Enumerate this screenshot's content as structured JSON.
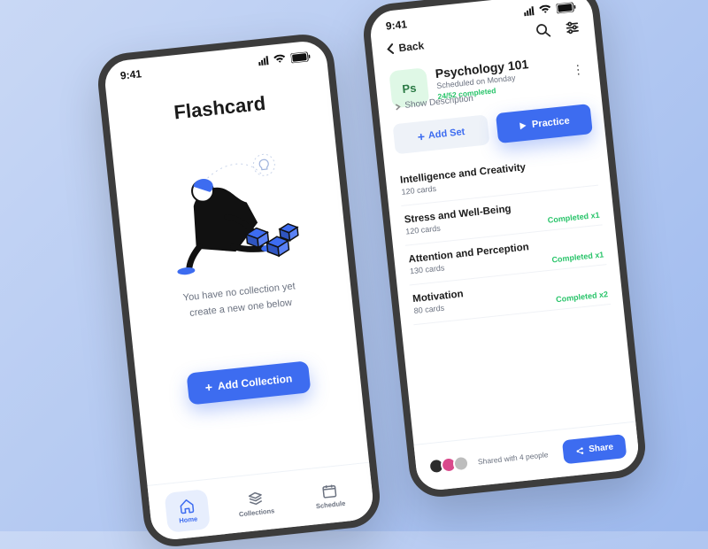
{
  "status_time": "9:41",
  "left": {
    "title": "Flashcard",
    "empty_line1": "You have no collection yet",
    "empty_line2": "create a new one below",
    "add_btn": "Add Collection",
    "tabs": [
      "Home",
      "Collections",
      "Schedule"
    ]
  },
  "right": {
    "back": "Back",
    "icon": "Ps",
    "title": "Psychology 101",
    "subtitle": "Scheduled on Monday",
    "progress": "24/52 completed",
    "show_desc": "Show Description",
    "add_set": "Add Set",
    "practice": "Practice",
    "sets": [
      {
        "title": "Intelligence and Creativity",
        "sub": "120 cards",
        "tag": ""
      },
      {
        "title": "Stress and Well-Being",
        "sub": "120 cards",
        "tag": "Completed x1"
      },
      {
        "title": "Attention and Perception",
        "sub": "130 cards",
        "tag": "Completed x1"
      },
      {
        "title": "Motivation",
        "sub": "80 cards",
        "tag": "Completed x2"
      }
    ],
    "shared": "Shared with 4 people",
    "share": "Share"
  }
}
